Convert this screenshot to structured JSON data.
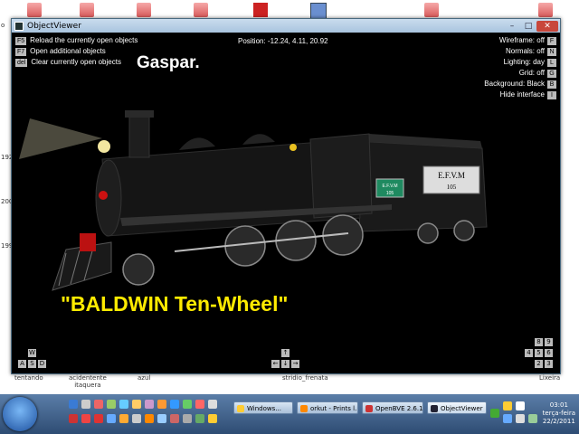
{
  "window": {
    "title": "ObjectViewer",
    "minimize": "–",
    "maximize": "□",
    "close": "✕"
  },
  "hud": {
    "left": [
      {
        "key": "F5",
        "label": "Reload the currently open objects"
      },
      {
        "key": "F7",
        "label": "Open additional objects"
      },
      {
        "key": "del",
        "label": "Clear currently open objects"
      }
    ],
    "position": "Position: -12.24, 4.11, 20.92",
    "right": [
      {
        "label": "Wireframe: off",
        "key": "F"
      },
      {
        "label": "Normals: off",
        "key": "N"
      },
      {
        "label": "Lighting: day",
        "key": "L"
      },
      {
        "label": "Grid: off",
        "key": "G"
      },
      {
        "label": "Background: Black",
        "key": "B"
      },
      {
        "label": "Hide interface",
        "key": "I"
      }
    ]
  },
  "overlay": {
    "title": "Gaspar.",
    "caption": "\"BALDWIN Ten-Wheel\""
  },
  "loco": {
    "tender_plate": "E.F.V.M",
    "tender_number": "105",
    "cab_plate": "E.F.V.M",
    "cab_number": "105"
  },
  "nav_keys": {
    "left": {
      "w": "W",
      "a": "A",
      "s": "S",
      "d": "D"
    },
    "center": {
      "top": "↑",
      "left": "←",
      "down": "↓",
      "right": "→"
    },
    "right": {
      "k8": "8",
      "k9": "9",
      "k4": "4",
      "k5": "5",
      "k6": "6",
      "k2": "2",
      "k3": "3"
    }
  },
  "desktop": {
    "side_labels": [
      "o",
      "192",
      "200",
      "199"
    ],
    "labels": [
      "tentando",
      "acidentente\nitaquera",
      "azul",
      "stridio_frenata",
      "Lixeira"
    ]
  },
  "taskbar": {
    "tasks": [
      "Windows...",
      "orkut - Prints l...",
      "OpenBVE 2.6.1",
      "ObjectViewer"
    ],
    "clock_time": "03:01",
    "clock_day": "terça-feira",
    "clock_date": "22/2/2011"
  },
  "colors": {
    "viewport_bg": "#000000",
    "caption": "#ffeb00",
    "titlebar": "#b8d0e8",
    "taskbar": "#3d5f8a"
  }
}
